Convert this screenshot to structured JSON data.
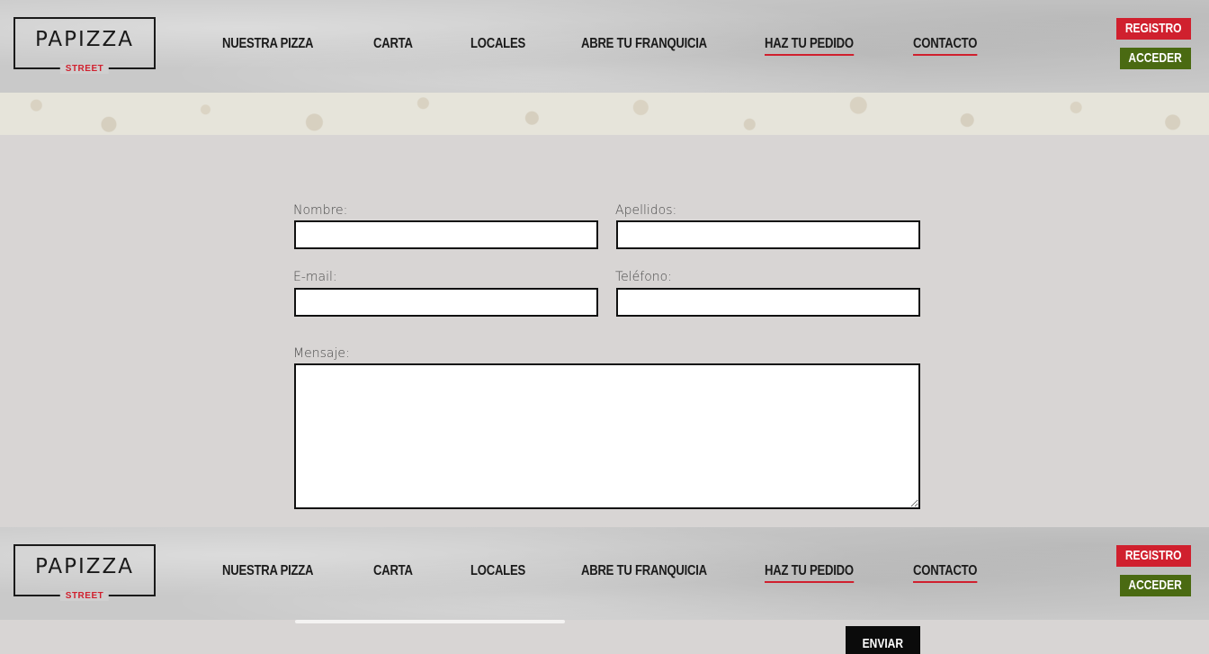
{
  "brand": {
    "name": "PAPIZZA",
    "sub": "STREET"
  },
  "nav": {
    "items": [
      {
        "label": "NUESTRA PIZZA"
      },
      {
        "label": "CARTA"
      },
      {
        "label": "LOCALES"
      },
      {
        "label": "ABRE TU FRANQUICIA"
      },
      {
        "label": "HAZ TU PEDIDO"
      },
      {
        "label": "CONTACTO"
      }
    ],
    "register_label": "REGISTRO",
    "login_label": "ACCEDER"
  },
  "form": {
    "nombre_label": "Nombre:",
    "nombre_value": "",
    "apellidos_label": "Apellidos:",
    "apellidos_value": "",
    "email_label": "E-mail:",
    "email_value": "",
    "telefono_label": "Teléfono:",
    "telefono_value": "",
    "mensaje_label": "Mensaje:",
    "mensaje_value": "",
    "submit_label": "ENVIAR"
  },
  "colors": {
    "accent_red": "#d0202e",
    "accent_green": "#4a6a12",
    "page_bg": "#d8d5d4"
  }
}
